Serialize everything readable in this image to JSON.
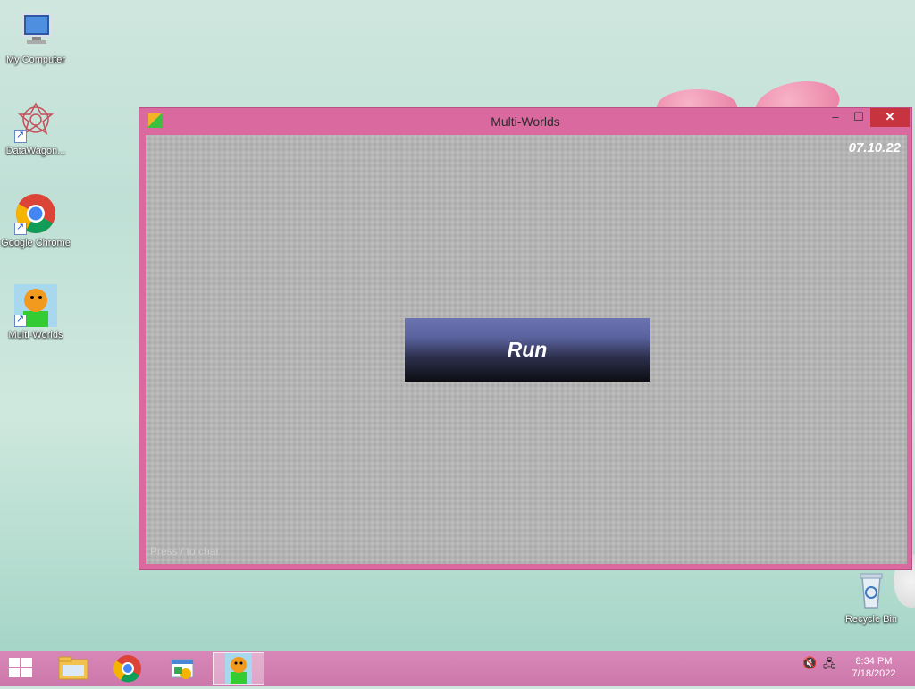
{
  "desktop": {
    "icons": [
      {
        "label": "My Computer"
      },
      {
        "label": "DataWagon..."
      },
      {
        "label": "Google Chrome"
      },
      {
        "label": "Multi-Worlds"
      }
    ],
    "recycle_bin": {
      "label": "Recycle Bin"
    }
  },
  "window": {
    "title": "Multi-Worlds",
    "minimize": "–",
    "maximize": "☐",
    "close": "✕",
    "date": "07.10.22",
    "run_label": "Run",
    "chat_hint": "Press / to chat"
  },
  "taskbar": {
    "clock_time": "8:34 PM",
    "clock_date": "7/18/2022",
    "volume_icon": "🔇",
    "network_icon": "🖧"
  }
}
